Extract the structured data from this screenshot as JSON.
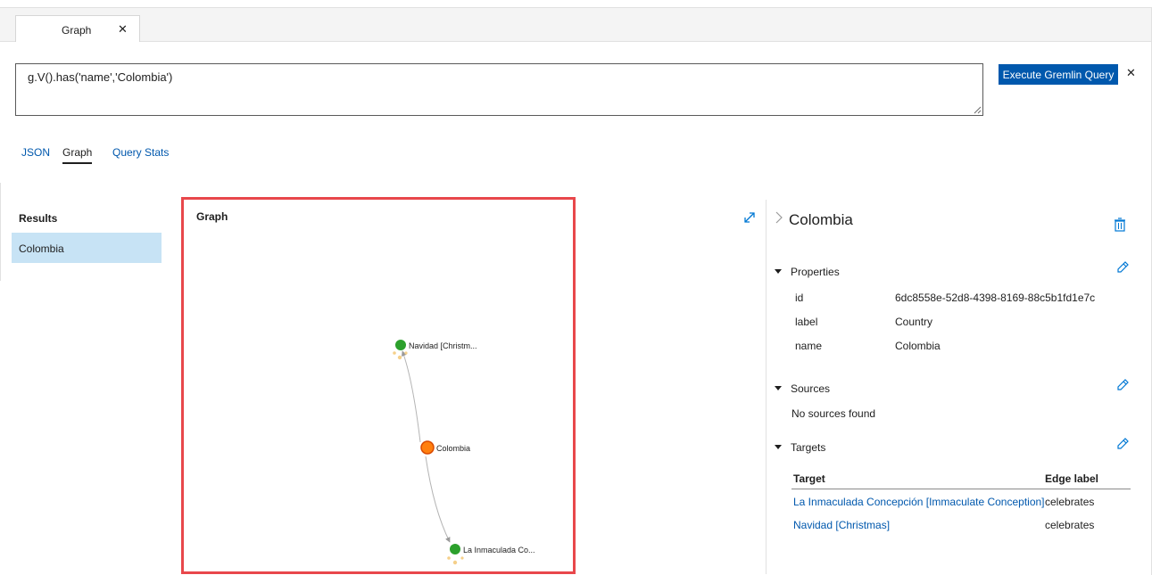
{
  "tab": {
    "label": "Graph",
    "close": "✕"
  },
  "query": {
    "text": "g.V().has('name','Colombia')"
  },
  "execute_button": "Execute Gremlin Query",
  "execute_close": "✕",
  "result_tabs": [
    {
      "label": "JSON",
      "active": false
    },
    {
      "label": "Graph",
      "active": true
    },
    {
      "label": "Query Stats",
      "active": false
    }
  ],
  "results": {
    "title": "Results",
    "items": [
      "Colombia"
    ]
  },
  "graph": {
    "title": "Graph",
    "nodes": [
      {
        "label": "Navidad [Christm...",
        "color": "#2ca02c",
        "role": "target"
      },
      {
        "label": "Colombia",
        "color": "#ff7f0e",
        "role": "selected"
      },
      {
        "label": "La Inmaculada Co...",
        "color": "#2ca02c",
        "role": "target"
      }
    ],
    "edge_color": "#b4b4b4",
    "highlight_color": "#e8474b"
  },
  "details": {
    "title": "Colombia",
    "properties": {
      "heading": "Properties",
      "rows": [
        {
          "key": "id",
          "value": "6dc8558e-52d8-4398-8169-88c5b1fd1e7c"
        },
        {
          "key": "label",
          "value": "Country"
        },
        {
          "key": "name",
          "value": "Colombia"
        }
      ]
    },
    "sources": {
      "heading": "Sources",
      "empty": "No sources found"
    },
    "targets": {
      "heading": "Targets",
      "col_target": "Target",
      "col_edge": "Edge label",
      "rows": [
        {
          "target": "La Inmaculada Concepción [Immaculate Conception]",
          "edge": "celebrates"
        },
        {
          "target": "Navidad [Christmas]",
          "edge": "celebrates"
        }
      ]
    }
  },
  "colors": {
    "accent": "#0058ad",
    "selection": "#c7e3f5"
  },
  "icons": [
    "close-icon",
    "resize-grip-icon",
    "expand-icon",
    "chevron-right-icon",
    "trash-icon",
    "pencil-icon",
    "triangle-down-icon"
  ]
}
